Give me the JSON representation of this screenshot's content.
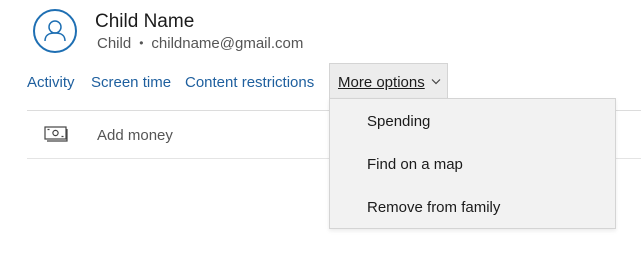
{
  "profile": {
    "name": "Child Name",
    "role": "Child",
    "separator": "•",
    "email": "childname@gmail.com",
    "avatar_icon": "person-icon"
  },
  "nav": {
    "activity": "Activity",
    "screen_time": "Screen time",
    "content_restrictions": "Content restrictions",
    "more_options": "More options",
    "more_icon": "chevron-down-icon"
  },
  "actions": {
    "add_money": "Add money",
    "add_money_icon": "money-bill-icon"
  },
  "dropdown": {
    "items": [
      {
        "label": "Spending"
      },
      {
        "label": "Find on a map"
      },
      {
        "label": "Remove from family"
      }
    ]
  },
  "colors": {
    "accent": "#1e6fb3",
    "link": "#1e5f9e",
    "dropdown_bg": "#f2f2f2"
  }
}
